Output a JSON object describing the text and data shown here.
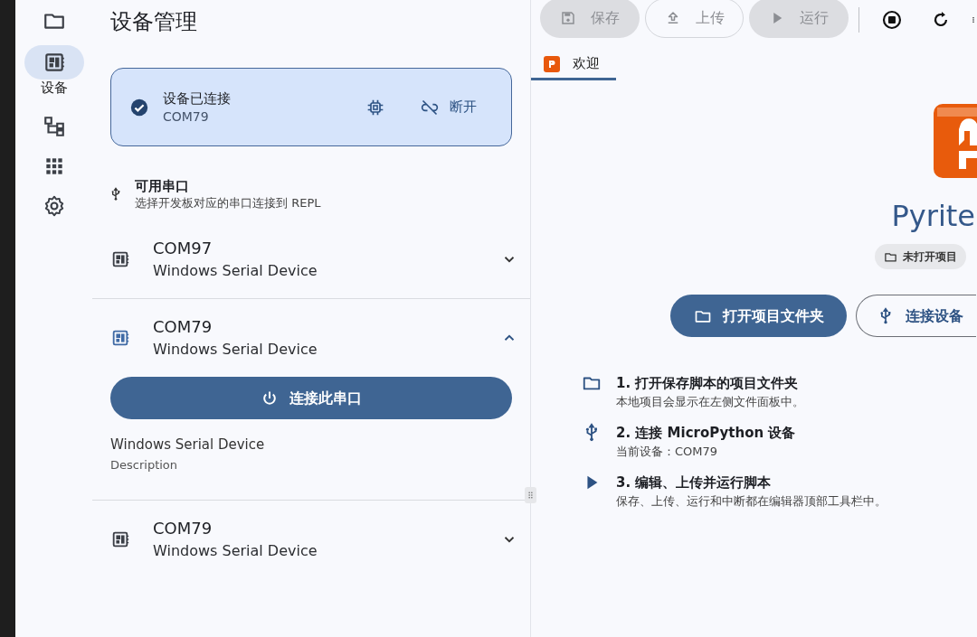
{
  "rail": [
    {
      "selected": false
    },
    {
      "label": "设备",
      "selected": true
    },
    {
      "selected": false
    },
    {
      "selected": false
    },
    {
      "selected": false
    }
  ],
  "device_panel": {
    "title": "设备管理",
    "status_card": {
      "connected": true,
      "title": "设备已连接",
      "port": "COM79",
      "disconnect": "断开"
    },
    "section": {
      "title": "可用串口",
      "subtitle": "选择开发板对应的串口连接到 REPL"
    },
    "ports": [
      {
        "name": "COM97",
        "description": "Windows Serial Device",
        "expanded": false
      },
      {
        "name": "COM79",
        "description": "Windows Serial Device",
        "expanded": true,
        "action": "连接此串口",
        "detail": "Windows Serial Device",
        "detail_caption": "Description"
      },
      {
        "name": "COM79",
        "description": "Windows Serial Device",
        "expanded": false
      }
    ]
  },
  "toolbar": [
    {
      "label": "保存",
      "disabled": true,
      "kind": "filled"
    },
    {
      "label": "上传",
      "disabled": true,
      "kind": "outlined"
    },
    {
      "label": "运行",
      "disabled": true,
      "kind": "filled"
    }
  ],
  "tabs": [
    {
      "label": "欢迎",
      "selected": true
    }
  ],
  "welcome": {
    "app_name": "Pyrite",
    "chip": "未打开项目",
    "buttons": [
      {
        "label": "打开项目文件夹",
        "kind": "primary"
      },
      {
        "label": "连接设备",
        "kind": "outlined"
      }
    ],
    "steps": [
      {
        "title": "1. 打开保存脚本的项目文件夹",
        "text": "本地项目会显示在左侧文件面板中。"
      },
      {
        "title": "2. 连接 MicroPython 设备",
        "text": "当前设备：COM79"
      },
      {
        "title": "3. 编辑、上传并运行脚本",
        "text": "保存、上传、运行和中断都在编辑器顶部工具栏中。"
      }
    ]
  }
}
